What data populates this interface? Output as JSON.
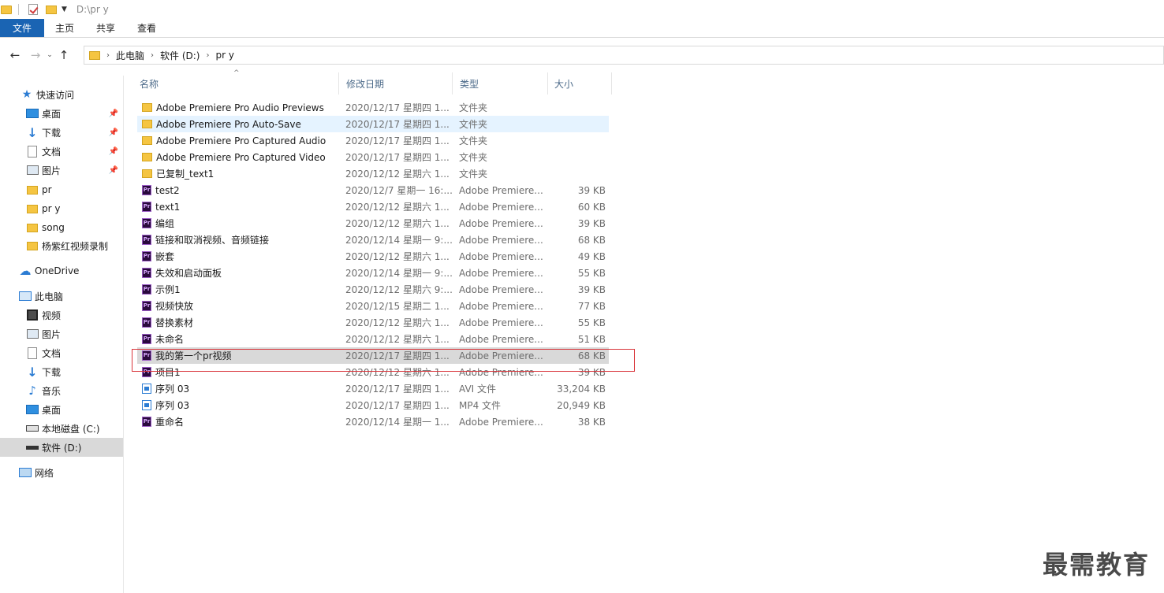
{
  "window": {
    "title": "D:\\pr y"
  },
  "ribbon": {
    "tabs": [
      "文件",
      "主页",
      "共享",
      "查看"
    ]
  },
  "address": {
    "crumbs": [
      "此电脑",
      "软件 (D:)",
      "pr y"
    ]
  },
  "sidebar": {
    "quick_access": "快速访问",
    "quick_items": [
      "桌面",
      "下载",
      "文档",
      "图片",
      "pr",
      "pr y",
      "song",
      "杨紫红视频录制"
    ],
    "onedrive": "OneDrive",
    "this_pc": "此电脑",
    "pc_items": [
      "视频",
      "图片",
      "文档",
      "下载",
      "音乐",
      "桌面",
      "本地磁盘 (C:)",
      "软件 (D:)"
    ],
    "network": "网络"
  },
  "columns": {
    "name": "名称",
    "date": "修改日期",
    "type": "类型",
    "size": "大小"
  },
  "files": [
    {
      "name": "Adobe Premiere Pro Audio Previews",
      "date": "2020/12/17 星期四 1...",
      "type": "文件夹",
      "size": "",
      "kind": "folder"
    },
    {
      "name": "Adobe Premiere Pro Auto-Save",
      "date": "2020/12/17 星期四 1...",
      "type": "文件夹",
      "size": "",
      "kind": "folder"
    },
    {
      "name": "Adobe Premiere Pro Captured Audio",
      "date": "2020/12/17 星期四 1...",
      "type": "文件夹",
      "size": "",
      "kind": "folder"
    },
    {
      "name": "Adobe Premiere Pro Captured Video",
      "date": "2020/12/17 星期四 1...",
      "type": "文件夹",
      "size": "",
      "kind": "folder"
    },
    {
      "name": "已复制_text1",
      "date": "2020/12/12 星期六 1...",
      "type": "文件夹",
      "size": "",
      "kind": "folder"
    },
    {
      "name": "test2",
      "date": "2020/12/7 星期一 16:...",
      "type": "Adobe Premiere...",
      "size": "39 KB",
      "kind": "pr"
    },
    {
      "name": "text1",
      "date": "2020/12/12 星期六 1...",
      "type": "Adobe Premiere...",
      "size": "60 KB",
      "kind": "pr"
    },
    {
      "name": "编组",
      "date": "2020/12/12 星期六 1...",
      "type": "Adobe Premiere...",
      "size": "39 KB",
      "kind": "pr"
    },
    {
      "name": "链接和取消视频、音频链接",
      "date": "2020/12/14 星期一 9:...",
      "type": "Adobe Premiere...",
      "size": "68 KB",
      "kind": "pr"
    },
    {
      "name": "嵌套",
      "date": "2020/12/12 星期六 1...",
      "type": "Adobe Premiere...",
      "size": "49 KB",
      "kind": "pr"
    },
    {
      "name": "失效和启动面板",
      "date": "2020/12/14 星期一 9:...",
      "type": "Adobe Premiere...",
      "size": "55 KB",
      "kind": "pr"
    },
    {
      "name": "示例1",
      "date": "2020/12/12 星期六 9:...",
      "type": "Adobe Premiere...",
      "size": "39 KB",
      "kind": "pr"
    },
    {
      "name": "视频快放",
      "date": "2020/12/15 星期二 1...",
      "type": "Adobe Premiere...",
      "size": "77 KB",
      "kind": "pr"
    },
    {
      "name": "替换素材",
      "date": "2020/12/12 星期六 1...",
      "type": "Adobe Premiere...",
      "size": "55 KB",
      "kind": "pr"
    },
    {
      "name": "未命名",
      "date": "2020/12/12 星期六 1...",
      "type": "Adobe Premiere...",
      "size": "51 KB",
      "kind": "pr"
    },
    {
      "name": "我的第一个pr视频",
      "date": "2020/12/17 星期四 1...",
      "type": "Adobe Premiere...",
      "size": "68 KB",
      "kind": "pr"
    },
    {
      "name": "项目1",
      "date": "2020/12/12 星期六 1...",
      "type": "Adobe Premiere...",
      "size": "39 KB",
      "kind": "pr"
    },
    {
      "name": "序列 03",
      "date": "2020/12/17 星期四 1...",
      "type": "AVI 文件",
      "size": "33,204 KB",
      "kind": "video"
    },
    {
      "name": "序列 03",
      "date": "2020/12/17 星期四 1...",
      "type": "MP4 文件",
      "size": "20,949 KB",
      "kind": "video"
    },
    {
      "name": "重命名",
      "date": "2020/12/14 星期一 1...",
      "type": "Adobe Premiere...",
      "size": "38 KB",
      "kind": "pr"
    }
  ],
  "watermark": "最需教育"
}
